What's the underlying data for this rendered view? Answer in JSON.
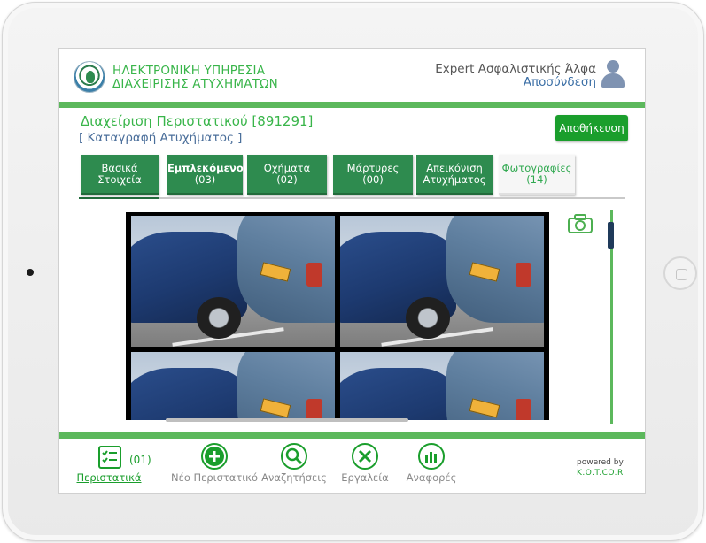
{
  "app": {
    "brand_line1": "ΗΛΕΚΤΡΟΝΙΚΗ ΥΠΗΡΕΣΙΑ",
    "brand_line2": "ΔΙΑΧΕΙΡΙΣΗΣ ΑΤΥΧΗΜΑΤΩΝ",
    "user_name": "Expert Ασφαλιστικής Άλφα",
    "logout_label": "Αποσύνδεση"
  },
  "page": {
    "title": "Διαχείριση Περιστατικού [891291]",
    "subtitle": "[ Καταγραφή Ατυχήματος ]",
    "save_label": "Αποθήκευση"
  },
  "tabs": [
    {
      "line1": "Βασικά",
      "line2": "Στοιχεία"
    },
    {
      "line1": "Εμπλεκόμενοι",
      "line2": "(03)"
    },
    {
      "line1": "Οχήματα",
      "line2": "(02)"
    },
    {
      "line1": "Μάρτυρες",
      "line2": "(00)"
    },
    {
      "line1": "Απεικόνιση",
      "line2": "Ατυχήματος"
    },
    {
      "line1": "Φωτογραφίες",
      "line2": "(14)"
    }
  ],
  "active_tab_index": 5,
  "gallery": {
    "photo_count_visible": 4,
    "camera_icon": "camera-icon"
  },
  "bottom_nav": {
    "incidents_label": "Περιστατικά",
    "incidents_count": "(01)",
    "new_incident_label": "Νέο Περιστατικό",
    "search_label": "Αναζητήσεις",
    "tools_label": "Εργαλεία",
    "reports_label": "Αναφορές"
  },
  "footer": {
    "powered_by": "powered by",
    "company": "K.O.T.CO.R"
  },
  "colors": {
    "accent_green": "#39b54a",
    "tab_green": "#2e8b4f",
    "button_green": "#1a9e2c",
    "link_blue": "#3a6ea5"
  }
}
